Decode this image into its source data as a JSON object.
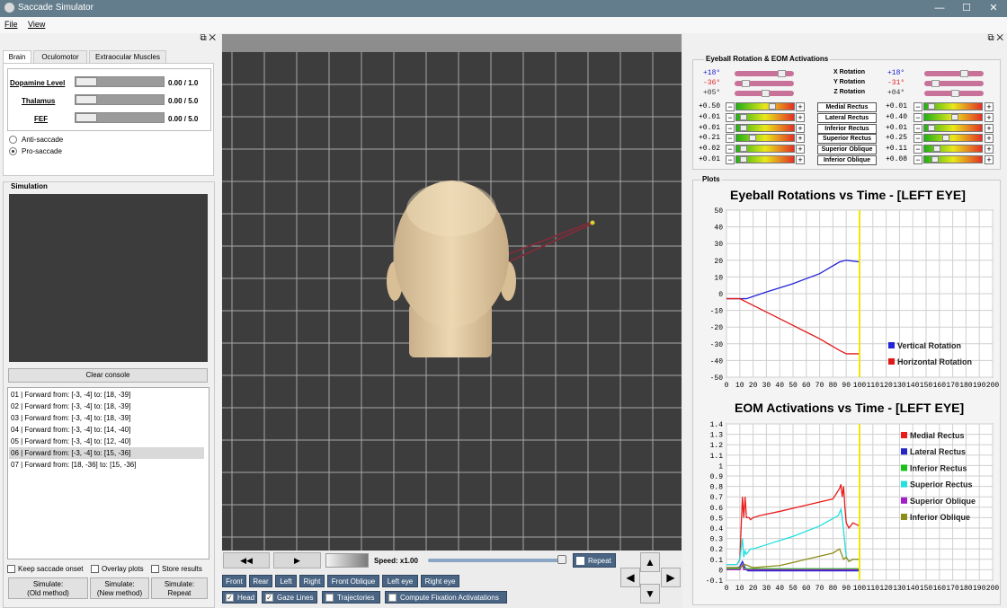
{
  "window": {
    "title": "Saccade Simulator",
    "min": "—",
    "max": "☐",
    "close": "✕"
  },
  "menu": {
    "file": "File",
    "view": "View"
  },
  "left": {
    "tabs": [
      "Brain",
      "Oculomotor",
      "Extraocular Muscles"
    ],
    "sliders": [
      {
        "label": "Dopamine Level",
        "value": "0.00 / 1.0",
        "level": 0
      },
      {
        "label": "Thalamus",
        "value": "0.00 / 5.0",
        "level": 0
      },
      {
        "label": "FEF",
        "value": "0.00 / 5.0",
        "level": 0
      }
    ],
    "radios": [
      {
        "label": "Anti-saccade",
        "checked": false
      },
      {
        "label": "Pro-saccade",
        "checked": true
      }
    ],
    "simulation_title": "Simulation",
    "clear_console": "Clear console",
    "log": [
      "01 | Forward from: [-3, -4] to: [18, -39]",
      "02 | Forward from: [-3, -4] to: [18, -39]",
      "03 | Forward from: [-3, -4] to: [18, -39]",
      "04 | Forward from: [-3, -4] to: [14, -40]",
      "05 | Forward from: [-3, -4] to: [12, -40]",
      "06 | Forward from: [-3, -4] to: [15, -36]",
      "07 | Forward from: [18, -36] to: [15, -36]"
    ],
    "checks": [
      "Keep saccade onset",
      "Overlay plots",
      "Store results"
    ],
    "sim_buttons": [
      "Simulate:\n(Old method)",
      "Simulate:\n(New method)",
      "Simulate:\nRepeat"
    ]
  },
  "center": {
    "rewind": "◀◀",
    "play": "▶",
    "speed": "Speed: x1.00",
    "repeat": "Repeat",
    "views": [
      "Front",
      "Rear",
      "Left",
      "Right",
      "Front Oblique",
      "Left eye",
      "Right eye"
    ],
    "toggles": [
      {
        "label": "Head",
        "checked": true
      },
      {
        "label": "Gaze Lines",
        "checked": true
      },
      {
        "label": "Trajectories",
        "checked": false
      },
      {
        "label": "Compute Fixation Activatations",
        "checked": false
      }
    ],
    "arrows": {
      "up": "▲",
      "down": "▼",
      "left": "◀",
      "right": "▶"
    }
  },
  "right": {
    "rot_title": "Eyeball Rotation & EOM Activations",
    "rotations": [
      {
        "label": "X Rotation",
        "left": "+18°",
        "right": "+18°",
        "lcolor": "#2222cc",
        "rcolor": "#2222cc"
      },
      {
        "label": "Y Rotation",
        "left": "-36°",
        "right": "-31°",
        "lcolor": "#dd2222",
        "rcolor": "#dd2222"
      },
      {
        "label": "Z Rotation",
        "left": "+05°",
        "right": "+04°",
        "lcolor": "#333333",
        "rcolor": "#333333"
      }
    ],
    "muscles": [
      {
        "name": "Medial Rectus",
        "left": "+0.50",
        "right": "+0.01"
      },
      {
        "name": "Lateral Rectus",
        "left": "+0.01",
        "right": "+0.40"
      },
      {
        "name": "Inferior Rectus",
        "left": "+0.01",
        "right": "+0.01"
      },
      {
        "name": "Superior Rectus",
        "left": "+0.21",
        "right": "+0.25"
      },
      {
        "name": "Superior Oblique",
        "left": "+0.02",
        "right": "+0.11"
      },
      {
        "name": "Inferior Oblique",
        "left": "+0.01",
        "right": "+0.08"
      }
    ],
    "plots_title": "Plots"
  },
  "chart_data": [
    {
      "type": "line",
      "title": "Eyeball Rotations vs Time - [LEFT EYE]",
      "xlim": [
        0,
        200
      ],
      "ylim": [
        -50,
        50
      ],
      "xticks": [
        0,
        10,
        20,
        30,
        40,
        50,
        60,
        70,
        80,
        90,
        100,
        110,
        120,
        130,
        140,
        150,
        160,
        170,
        180,
        190,
        200
      ],
      "yticks": [
        50,
        40,
        30,
        20,
        10,
        0,
        -10,
        -20,
        -30,
        -40,
        -50
      ],
      "series": [
        {
          "name": "Vertical Rotation",
          "color": "#2424d8",
          "x": [
            0,
            10,
            15,
            30,
            50,
            70,
            85,
            90,
            100
          ],
          "y": [
            -3,
            -3,
            -3,
            1,
            6,
            12,
            19,
            20,
            19
          ]
        },
        {
          "name": "Horizontal Rotation",
          "color": "#e01818",
          "x": [
            0,
            10,
            15,
            30,
            50,
            70,
            85,
            90,
            100
          ],
          "y": [
            -3,
            -3,
            -5,
            -11,
            -19,
            -27,
            -34,
            -36,
            -36
          ]
        }
      ],
      "marker_x": 100
    },
    {
      "type": "line",
      "title": "EOM Activations vs Time - [LEFT EYE]",
      "xlim": [
        0,
        200
      ],
      "ylim": [
        -0.1,
        1.4
      ],
      "xticks": [
        0,
        10,
        20,
        30,
        40,
        50,
        60,
        70,
        80,
        90,
        100,
        110,
        120,
        130,
        140,
        150,
        160,
        170,
        180,
        190,
        200
      ],
      "yticks": [
        1.4,
        1.3,
        1.2,
        1.1,
        1.0,
        0.9,
        0.8,
        0.7,
        0.6,
        0.5,
        0.4,
        0.3,
        0.2,
        0.1,
        0,
        -0.1
      ],
      "series": [
        {
          "name": "Medial Rectus",
          "color": "#e81c1c",
          "x": [
            0,
            8,
            10,
            12,
            13,
            14,
            15,
            16,
            17,
            18,
            20,
            25,
            40,
            60,
            80,
            85,
            86,
            87,
            88,
            89,
            90,
            92,
            95,
            100
          ],
          "y": [
            0.05,
            0.05,
            0.1,
            0.7,
            0.5,
            0.7,
            0.5,
            0.5,
            0.5,
            0.48,
            0.5,
            0.52,
            0.56,
            0.62,
            0.68,
            0.78,
            0.82,
            0.7,
            0.8,
            0.6,
            0.45,
            0.4,
            0.45,
            0.42
          ]
        },
        {
          "name": "Lateral Rectus",
          "color": "#2626c8",
          "x": [
            0,
            8,
            10,
            12,
            14,
            15,
            16,
            100
          ],
          "y": [
            0.02,
            0.02,
            0.03,
            0.08,
            0.02,
            0,
            -0.01,
            -0.01
          ]
        },
        {
          "name": "Inferior Rectus",
          "color": "#18c018",
          "x": [
            0,
            10,
            12,
            14,
            100
          ],
          "y": [
            0.01,
            0.01,
            0.04,
            0.01,
            0.01
          ]
        },
        {
          "name": "Superior Rectus",
          "color": "#20e0e0",
          "x": [
            0,
            8,
            10,
            12,
            13,
            14,
            15,
            18,
            20,
            30,
            50,
            70,
            84,
            85,
            86,
            87,
            88,
            89,
            90,
            92,
            95,
            100
          ],
          "y": [
            0.05,
            0.05,
            0.1,
            0.3,
            0.12,
            0.18,
            0.15,
            0.2,
            0.2,
            0.24,
            0.32,
            0.42,
            0.52,
            0.55,
            0.58,
            0.5,
            0.38,
            0.25,
            0.12,
            0.08,
            0.1,
            0.1
          ]
        },
        {
          "name": "Superior Oblique",
          "color": "#a020c8",
          "x": [
            0,
            10,
            12,
            13,
            14,
            100
          ],
          "y": [
            0.0,
            0.0,
            0.05,
            0.0,
            0.0,
            0.0
          ]
        },
        {
          "name": "Inferior Oblique",
          "color": "#8c8c18",
          "x": [
            0,
            10,
            14,
            20,
            40,
            60,
            80,
            85,
            88,
            90,
            92,
            95,
            100
          ],
          "y": [
            0.02,
            0.02,
            0.05,
            0.02,
            0.04,
            0.1,
            0.16,
            0.2,
            0.1,
            0.12,
            0.08,
            0.1,
            0.1
          ]
        }
      ],
      "marker_x": 100
    }
  ]
}
